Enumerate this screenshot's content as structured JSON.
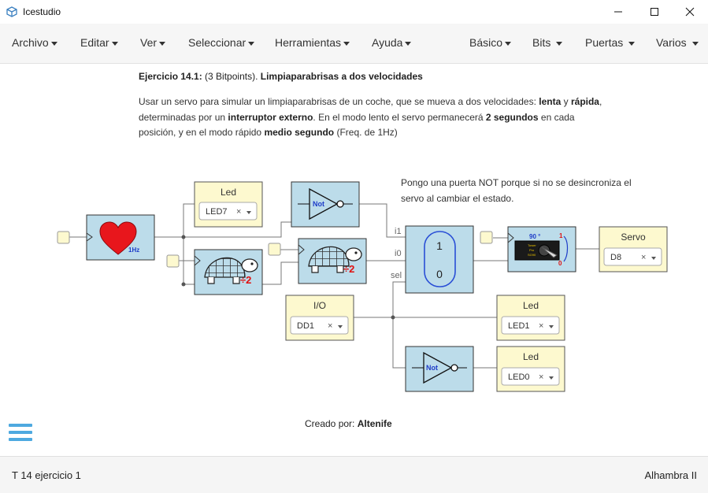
{
  "window": {
    "title": "Icestudio",
    "minimize_glyph": "—",
    "maximize_glyph": "☐",
    "close_glyph": "✕"
  },
  "menu_left": [
    "Archivo",
    "Editar",
    "Ver",
    "Seleccionar",
    "Herramientas",
    "Ayuda"
  ],
  "menu_right": [
    "Básico",
    "Bits",
    "Puertas",
    "Varios"
  ],
  "description": {
    "heading_prefix": "Ejercicio 14.1:",
    "heading_points": " (3 Bitpoints). ",
    "heading_title": "Limpiaparabrisas a dos velocidades",
    "line1_a": "Usar un servo para simular un limpiaparabrisas de un coche, que se mueva a dos velocidades: ",
    "line1_b": "lenta",
    "line1_c": " y ",
    "line1_d": "rápida",
    "line1_e": ",",
    "line2_a": "determinadas por un ",
    "line2_b": "interruptor externo",
    "line2_c": ". En el modo lento el servo permanecerá ",
    "line2_d": "2 segundos",
    "line2_e": " en cada",
    "line3_a": "posición, y en el modo rápido ",
    "line3_b": "medio segundo",
    "line3_c": " (Freq. de 1Hz)"
  },
  "note": {
    "line1": "Pongo una puerta NOT porque si no se desincroniza el",
    "line2": "servo al cambiar el estado."
  },
  "circuit": {
    "heart_label": "1Hz",
    "div_label": "÷2",
    "not_label": "Not",
    "mux": {
      "in1": "i1",
      "in0": "i0",
      "sel": "sel",
      "top": "1",
      "bottom": "0"
    },
    "servo_icon": {
      "angle": "90 °",
      "pos1": "1",
      "pos0": "0",
      "chip_l1": "Tower",
      "chip_l2": "Pro",
      "chip_l3": "SG90"
    },
    "clear_glyph": "×",
    "led_top": {
      "title": "Led",
      "value": "LED7"
    },
    "led_mid": {
      "title": "Led",
      "value": "LED1"
    },
    "led_bot": {
      "title": "Led",
      "value": "LED0"
    },
    "io": {
      "title": "I/O",
      "value": "DD1"
    },
    "servo": {
      "title": "Servo",
      "value": "D8"
    }
  },
  "credit": {
    "prefix": "Creado por: ",
    "author": "Altenife"
  },
  "status": {
    "left": "T 14 ejercicio 1",
    "right": "Alhambra II"
  },
  "colors": {
    "block_blue": "#bcdcea",
    "io_yellow": "#fdf9cf",
    "accent": "#4ea9e0"
  }
}
